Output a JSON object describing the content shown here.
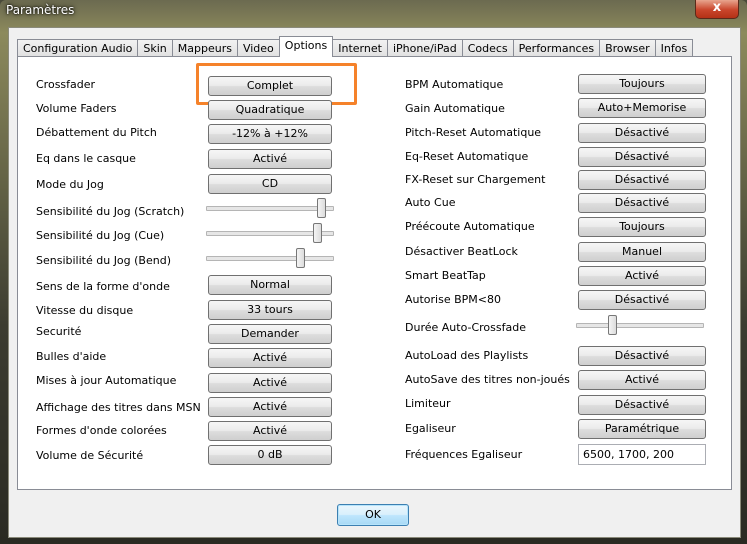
{
  "window": {
    "title": "Paramètres",
    "close_glyph": "x"
  },
  "tabs": [
    {
      "label": "Configuration Audio",
      "active": false
    },
    {
      "label": "Skin",
      "active": false
    },
    {
      "label": "Mappeurs",
      "active": false
    },
    {
      "label": "Video",
      "active": false
    },
    {
      "label": "Options",
      "active": true
    },
    {
      "label": "Internet",
      "active": false
    },
    {
      "label": "iPhone/iPad",
      "active": false
    },
    {
      "label": "Codecs",
      "active": false
    },
    {
      "label": "Performances",
      "active": false
    },
    {
      "label": "Browser",
      "active": false
    },
    {
      "label": "Infos",
      "active": false
    }
  ],
  "left": {
    "crossfader": {
      "label": "Crossfader",
      "value": "Complet"
    },
    "volume_faders": {
      "label": "Volume Faders",
      "value": "Quadratique"
    },
    "pitch_range": {
      "label": "Débattement du Pitch",
      "value": "-12% à +12%"
    },
    "eq_headphones": {
      "label": "Eq dans le casque",
      "value": "Activé"
    },
    "jog_mode": {
      "label": "Mode du Jog",
      "value": "CD"
    },
    "jog_scratch": {
      "label": "Sensibilité du Jog (Scratch)",
      "level": 0.93
    },
    "jog_cue": {
      "label": "Sensibilité du Jog (Cue)",
      "level": 0.9
    },
    "jog_bend": {
      "label": "Sensibilité du Jog (Bend)",
      "level": 0.76
    },
    "waveform_direction": {
      "label": "Sens de la forme d'onde",
      "value": "Normal"
    },
    "disc_speed": {
      "label": "Vitesse du disque",
      "value": "33 tours"
    },
    "security": {
      "label": "Securité",
      "value": "Demander"
    },
    "tooltips": {
      "label": "Bulles d'aide",
      "value": "Activé"
    },
    "auto_update": {
      "label": "Mises à jour Automatique",
      "value": "Activé"
    },
    "msn_titles": {
      "label": "Affichage des titres dans MSN",
      "value": "Activé"
    },
    "colored_waveforms": {
      "label": "Formes d'onde colorées",
      "value": "Activé"
    },
    "safety_volume": {
      "label": "Volume de Sécurité",
      "value": "0 dB"
    }
  },
  "right": {
    "auto_bpm": {
      "label": "BPM Automatique",
      "value": "Toujours"
    },
    "auto_gain": {
      "label": "Gain Automatique",
      "value": "Auto+Memorise"
    },
    "auto_pitch_reset": {
      "label": "Pitch-Reset Automatique",
      "value": "Désactivé"
    },
    "auto_eq_reset": {
      "label": "Eq-Reset Automatique",
      "value": "Désactivé"
    },
    "fx_reset_load": {
      "label": "FX-Reset sur Chargement",
      "value": "Désactivé"
    },
    "auto_cue": {
      "label": "Auto Cue",
      "value": "Désactivé"
    },
    "auto_prelisten": {
      "label": "Préécoute Automatique",
      "value": "Toujours"
    },
    "disable_beatlock": {
      "label": "Désactiver BeatLock",
      "value": "Manuel"
    },
    "smart_beattap": {
      "label": "Smart BeatTap",
      "value": "Activé"
    },
    "authorize_bpm": {
      "label": "Autorise BPM<80",
      "value": "Désactivé"
    },
    "auto_crossfade": {
      "label": "Durée Auto-Crossfade",
      "level": 0.27
    },
    "autoload_playlists": {
      "label": "AutoLoad des Playlists",
      "value": "Désactivé"
    },
    "autosave_unplayed": {
      "label": "AutoSave des titres non-joués",
      "value": "Activé"
    },
    "limiter": {
      "label": "Limiteur",
      "value": "Désactivé"
    },
    "equalizer": {
      "label": "Egaliseur",
      "value": "Paramétrique"
    },
    "eq_frequencies": {
      "label": "Fréquences Egaliseur",
      "value": "6500, 1700, 200"
    }
  },
  "footer": {
    "ok_label": "OK"
  },
  "colors": {
    "highlight": "#f5822a",
    "ok_border": "#3c7fb1"
  }
}
